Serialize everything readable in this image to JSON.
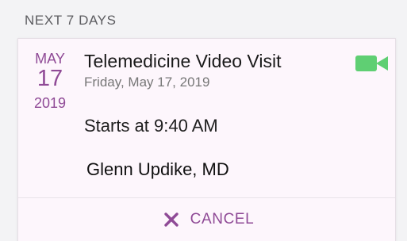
{
  "section": {
    "title": "NEXT 7 DAYS"
  },
  "appointment": {
    "month": "MAY",
    "day": "17",
    "year": "2019",
    "title": "Telemedicine Video Visit",
    "full_date": "Friday, May 17, 2019",
    "start_time": "Starts at 9:40 AM",
    "provider": "Glenn Updike, MD",
    "type_icon": "video-camera-icon"
  },
  "actions": {
    "cancel_label": "CANCEL",
    "cancel_icon": "close-icon"
  },
  "colors": {
    "accent": "#8f4a96",
    "video_icon": "#5fcf73",
    "card_bg": "#fdf6fc",
    "page_bg": "#f3f3f5"
  }
}
